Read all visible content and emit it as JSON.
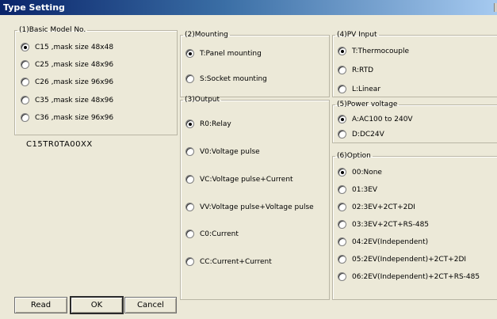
{
  "window": {
    "title": "Type Setting"
  },
  "basic_model": {
    "legend": "(1)Basic Model No.",
    "options": [
      {
        "label": "C15 ,mask size 48x48",
        "checked": true
      },
      {
        "label": "C25 ,mask size 48x96",
        "checked": false
      },
      {
        "label": "C26 ,mask size 96x96",
        "checked": false
      },
      {
        "label": "C35 ,mask size 48x96",
        "checked": false
      },
      {
        "label": "C36 ,mask size 96x96",
        "checked": false
      }
    ],
    "model_code": "C15TR0TA00XX"
  },
  "mounting": {
    "legend": "(2)Mounting",
    "options": [
      {
        "label": "T:Panel mounting",
        "checked": true
      },
      {
        "label": "S:Socket mounting",
        "checked": false
      }
    ]
  },
  "output": {
    "legend": "(3)Output",
    "options": [
      {
        "label": "R0:Relay",
        "checked": true
      },
      {
        "label": "V0:Voltage pulse",
        "checked": false
      },
      {
        "label": "VC:Voltage pulse+Current",
        "checked": false
      },
      {
        "label": "VV:Voltage pulse+Voltage pulse",
        "checked": false
      },
      {
        "label": "C0:Current",
        "checked": false
      },
      {
        "label": "CC:Current+Current",
        "checked": false
      }
    ]
  },
  "pv_input": {
    "legend": "(4)PV Input",
    "options": [
      {
        "label": "T:Thermocouple",
        "checked": true
      },
      {
        "label": "R:RTD",
        "checked": false
      },
      {
        "label": "L:Linear",
        "checked": false
      }
    ]
  },
  "power_voltage": {
    "legend": "(5)Power voltage",
    "options": [
      {
        "label": "A:AC100 to 240V",
        "checked": true
      },
      {
        "label": "D:DC24V",
        "checked": false
      }
    ]
  },
  "option": {
    "legend": "(6)Option",
    "options": [
      {
        "label": "00:None",
        "checked": true
      },
      {
        "label": "01:3EV",
        "checked": false
      },
      {
        "label": "02:3EV+2CT+2DI",
        "checked": false
      },
      {
        "label": "03:3EV+2CT+RS-485",
        "checked": false
      },
      {
        "label": "04:2EV(Independent)",
        "checked": false
      },
      {
        "label": "05:2EV(Independent)+2CT+2DI",
        "checked": false
      },
      {
        "label": "06:2EV(Independent)+2CT+RS-485",
        "checked": false
      }
    ]
  },
  "buttons": {
    "read": "Read",
    "ok": "OK",
    "cancel": "Cancel"
  }
}
